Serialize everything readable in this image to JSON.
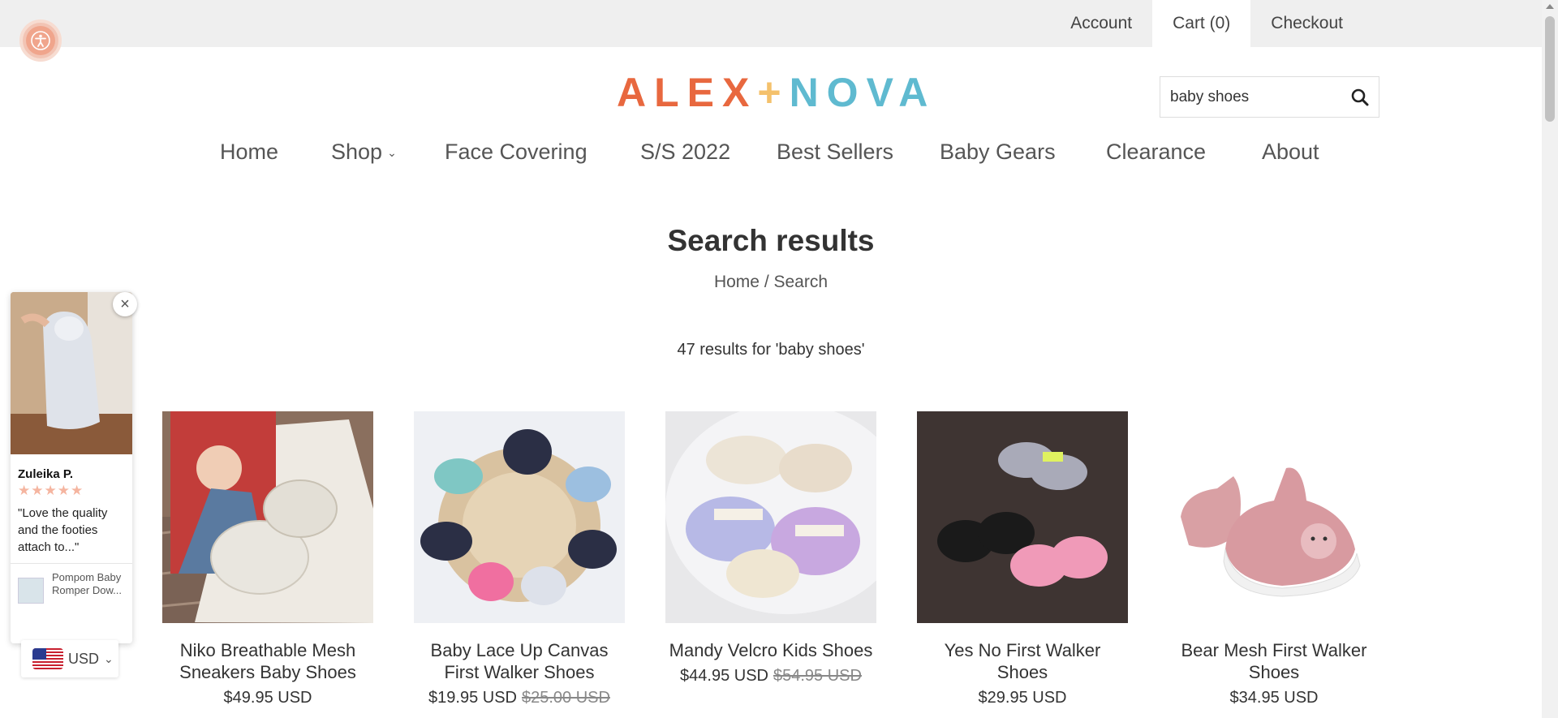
{
  "header": {
    "links": [
      {
        "label": "Account"
      },
      {
        "label": "Cart (0)"
      },
      {
        "label": "Checkout"
      }
    ]
  },
  "logo": {
    "part1": "ALEX",
    "plus": "+",
    "part2": "NOVA"
  },
  "search": {
    "value": "baby shoes",
    "icon": "search-icon"
  },
  "nav": {
    "items": [
      {
        "label": "Home"
      },
      {
        "label": "Shop"
      },
      {
        "label": "Face Covering"
      },
      {
        "label": "S/S 2022"
      },
      {
        "label": "Best Sellers"
      },
      {
        "label": "Baby Gears"
      },
      {
        "label": "Clearance"
      },
      {
        "label": "About"
      }
    ]
  },
  "page": {
    "title": "Search results",
    "breadcrumb": {
      "home": "Home",
      "sep": "/",
      "current": "Search"
    },
    "result_count": "47 results for 'baby shoes'"
  },
  "products": [
    {
      "name": "Niko Breathable Mesh Sneakers Baby Shoes",
      "price": "$49.95 USD",
      "old_price": ""
    },
    {
      "name": "Baby Lace Up Canvas First Walker Shoes",
      "price": "$19.95 USD",
      "old_price": "$25.00 USD"
    },
    {
      "name": "Mandy Velcro Kids Shoes",
      "price": "$44.95 USD",
      "old_price": "$54.95 USD"
    },
    {
      "name": "Yes No First Walker Shoes",
      "price": "$29.95 USD",
      "old_price": ""
    },
    {
      "name": "Bear Mesh First Walker Shoes",
      "price": "$34.95 USD",
      "old_price": ""
    }
  ],
  "review_widget": {
    "reviewer": "Zuleika P.",
    "stars": "★★★★★",
    "quote": "\"Love the quality and the footies attach to...\"",
    "product": "Pompom Baby Romper Dow...",
    "close": "×"
  },
  "currency": {
    "code": "USD"
  },
  "colors": {
    "logo_orange": "#e8683f",
    "logo_yellow": "#f4c16c",
    "logo_blue": "#5fbad0",
    "topbar": "#efefef"
  }
}
